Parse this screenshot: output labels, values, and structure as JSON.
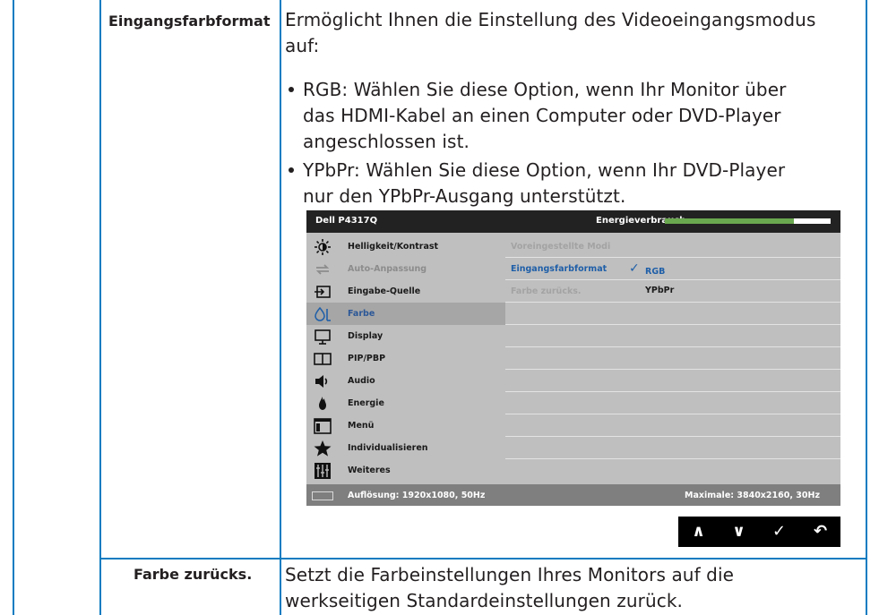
{
  "rows": [
    {
      "name": "Eingangsfarbformat",
      "description_lines": [
        "Ermöglicht Ihnen die Einstellung des Videoeingangsmodus",
        "auf:"
      ],
      "bullets": [
        {
          "lines": [
            "RGB: Wählen Sie diese Option, wenn Ihr Monitor über",
            "das HDMI-Kabel an einen Computer oder DVD-Player",
            "angeschlossen ist."
          ]
        },
        {
          "lines": [
            "YPbPr: Wählen Sie diese Option, wenn Ihr DVD-Player",
            "nur den YPbPr-Ausgang unterstützt."
          ]
        }
      ]
    },
    {
      "name": "Farbe zurücks.",
      "description_lines": [
        "Setzt die Farbeinstellungen Ihres Monitors auf die",
        "werkseitigen Standardeinstellungen zurück."
      ]
    }
  ],
  "osd": {
    "title": "Dell P4317Q",
    "energy_label": "Energieverbrauch",
    "energy_level": 0.78,
    "menu_items": [
      {
        "label": "Helligkeit/Kontrast",
        "icon": "brightness-icon",
        "state": "normal"
      },
      {
        "label": "Auto-Anpassung",
        "icon": "auto-adjust-icon",
        "state": "dim"
      },
      {
        "label": "Eingabe-Quelle",
        "icon": "input-source-icon",
        "state": "normal"
      },
      {
        "label": "Farbe",
        "icon": "color-icon",
        "state": "selected"
      },
      {
        "label": "Display",
        "icon": "display-icon",
        "state": "normal"
      },
      {
        "label": "PIP/PBP",
        "icon": "pip-pbp-icon",
        "state": "normal"
      },
      {
        "label": "Audio",
        "icon": "audio-icon",
        "state": "normal"
      },
      {
        "label": "Energie",
        "icon": "energy-icon",
        "state": "normal"
      },
      {
        "label": "Menü",
        "icon": "menu-icon",
        "state": "normal"
      },
      {
        "label": "Individualisieren",
        "icon": "star-icon",
        "state": "normal"
      },
      {
        "label": "Weiteres",
        "icon": "others-icon",
        "state": "normal"
      }
    ],
    "submenu": {
      "preset_modes": "Voreingestellte Modi",
      "input_color_format": "Eingangsfarbformat",
      "option_rgb": "RGB",
      "reset_color": "Farbe zurücks.",
      "option_ypbpr": "YPbPr"
    },
    "footer": {
      "resolution": "Auflösung: 1920x1080, 50Hz",
      "maximum": "Maximale: 3840x2160, 30Hz"
    },
    "nav_buttons": [
      {
        "glyph": "∧",
        "icon": "up-icon"
      },
      {
        "glyph": "∨",
        "icon": "down-icon"
      },
      {
        "glyph": "✓",
        "icon": "check-icon"
      },
      {
        "glyph": "↶",
        "icon": "back-icon"
      }
    ]
  },
  "colors": {
    "table_line": "#0b7cc1",
    "osd_highlight": "#1f5fa8",
    "energy_green": "#6aa84f"
  }
}
